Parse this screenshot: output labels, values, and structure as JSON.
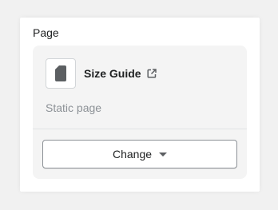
{
  "section": {
    "title": "Page"
  },
  "page": {
    "name": "Size Guide",
    "type": "Static page",
    "thumbnail_icon": "document-icon",
    "link_icon": "external-link-icon"
  },
  "actions": {
    "change_label": "Change",
    "change_icon": "caret-down-icon"
  },
  "colors": {
    "text": "#202223",
    "subdued": "#8c9196",
    "panel_bg": "#f4f4f4"
  }
}
